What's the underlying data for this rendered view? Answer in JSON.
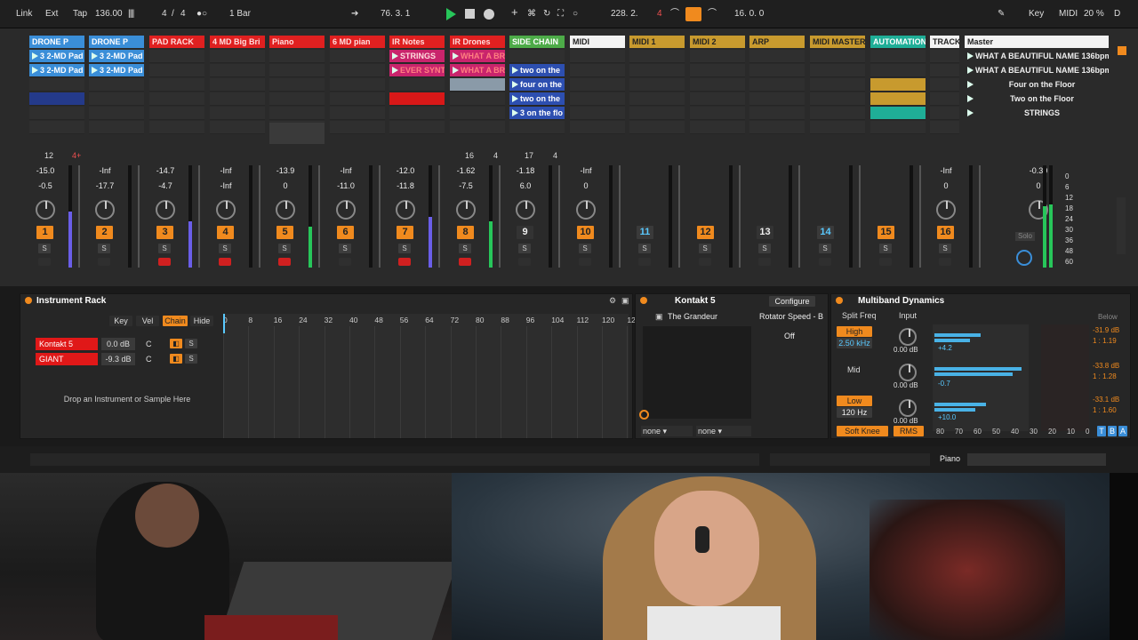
{
  "topbar": {
    "link": "Link",
    "ext": "Ext",
    "tap": "Tap",
    "tempo": "136.00",
    "meter_num": "4",
    "meter_slash": "/",
    "meter_den": "4",
    "metronome": "●○",
    "quant": "1 Bar",
    "position": "76. 3. 1",
    "loop_start": "228. 2.",
    "loop_marker": "4",
    "loop_len": "16. 0. 0",
    "key": "Key",
    "midi": "MIDI",
    "cpu": "20 %",
    "d": "D"
  },
  "tracks": [
    {
      "name": "DRONE P",
      "color": "#3a8ed8",
      "text": "#fff"
    },
    {
      "name": "DRONE P",
      "color": "#3a8ed8",
      "text": "#fff"
    },
    {
      "name": "PAD RACK",
      "color": "#e02020",
      "text": "#ffdede"
    },
    {
      "name": "4 MD Big Bri",
      "color": "#e02020",
      "text": "#ffdede"
    },
    {
      "name": "Piano",
      "color": "#e02020",
      "text": "#ffdede"
    },
    {
      "name": "6 MD pian",
      "color": "#e02020",
      "text": "#ffdede"
    },
    {
      "name": "IR Notes",
      "color": "#e02020",
      "text": "#ffdede"
    },
    {
      "name": "IR Drones",
      "color": "#e02020",
      "text": "#ffdede"
    },
    {
      "name": "SIDE CHAIN",
      "color": "#4dab48",
      "text": "#fff"
    },
    {
      "name": "MIDI",
      "color": "#f2f2f2",
      "text": "#222"
    },
    {
      "name": "MIDI 1",
      "color": "#c89a2e",
      "text": "#222"
    },
    {
      "name": "MIDI 2",
      "color": "#c89a2e",
      "text": "#222"
    },
    {
      "name": "ARP",
      "color": "#c89a2e",
      "text": "#222"
    },
    {
      "name": "MIDI MASTER",
      "color": "#c89a2e",
      "text": "#222"
    },
    {
      "name": "AUTOMATION",
      "color": "#1fae97",
      "text": "#fff"
    },
    {
      "name": "TRACKS",
      "color": "#f2f2f2",
      "text": "#222"
    },
    {
      "name": "Master",
      "color": "#f2f2f2",
      "text": "#222"
    }
  ],
  "clips": {
    "c1_1": "3 2-MD Pad",
    "c2_1": "3 2-MD Pad",
    "c1_7": "STRINGS",
    "c2_7": "EVER SYNT",
    "c4_7": "STRINGS",
    "c1_8": "WHAT A BR",
    "c2_8": "WHAT A BR",
    "c2_9": "two on the",
    "c3_9": "four on the",
    "c4_9": "two on the",
    "c5_9": "3 on the flo",
    "m1": "WHAT A BEAUTIFUL NAME 136bpm",
    "m2": "WHAT A BEAUTIFUL NAME 136bpm",
    "m3": "Four on the Floor",
    "m4": "Two on the Floor",
    "m5": "STRINGS"
  },
  "io": {
    "t1": "12",
    "t1b": "4+",
    "t8": "16",
    "t8b": "4",
    "t9": "17",
    "t9b": "4"
  },
  "volumes": [
    {
      "peak": "-15.0",
      "vol": "-0.5"
    },
    {
      "peak": "-Inf",
      "vol": "-17.7"
    },
    {
      "peak": "-14.7",
      "vol": "-4.7"
    },
    {
      "peak": "-Inf",
      "vol": "-Inf"
    },
    {
      "peak": "-13.9",
      "vol": "0"
    },
    {
      "peak": "-Inf",
      "vol": "-11.0"
    },
    {
      "peak": "-12.0",
      "vol": "-11.8"
    },
    {
      "peak": "-1.62",
      "vol": "-7.5"
    },
    {
      "peak": "-1.18",
      "vol": "6.0"
    },
    {
      "peak": "-Inf",
      "vol": "0"
    },
    {
      "peak": "",
      "vol": ""
    },
    {
      "peak": "",
      "vol": ""
    },
    {
      "peak": "",
      "vol": ""
    },
    {
      "peak": "",
      "vol": ""
    },
    {
      "peak": "",
      "vol": ""
    },
    {
      "peak": "-Inf",
      "vol": "0"
    },
    {
      "peak": "-0.30",
      "vol": "0"
    }
  ],
  "numbers": [
    "1",
    "2",
    "3",
    "4",
    "5",
    "6",
    "7",
    "8",
    "9",
    "10",
    "11",
    "12",
    "13",
    "14",
    "15",
    "16"
  ],
  "solo_label": "S",
  "master_solo": "Solo",
  "master_scale": [
    "0",
    "6",
    "12",
    "18",
    "24",
    "30",
    "36",
    "48",
    "60"
  ],
  "rack": {
    "title": "Instrument Rack",
    "key": "Key",
    "vel": "Vel",
    "chain": "Chain",
    "hide": "Hide",
    "chains": [
      {
        "name": "Kontakt 5",
        "vol": "0.0 dB",
        "pan": "C",
        "s": "S"
      },
      {
        "name": "GIANT",
        "vol": "-9.3 dB",
        "pan": "C",
        "s": "S"
      }
    ],
    "drop": "Drop an Instrument or Sample Here",
    "keys": [
      "0",
      "8",
      "16",
      "24",
      "32",
      "40",
      "48",
      "56",
      "64",
      "72",
      "80",
      "88",
      "96",
      "104",
      "112",
      "120",
      "127"
    ]
  },
  "kontakt": {
    "title": "Kontakt 5",
    "configure": "Configure",
    "preset": "The Grandeur",
    "param": "Rotator Speed - B",
    "state": "Off",
    "sel1": "none",
    "sel2": "none"
  },
  "multiband": {
    "title": "Multiband Dynamics",
    "split": "Split Freq",
    "input": "Input",
    "below": "Below",
    "high": "High",
    "high_freq": "2.50 kHz",
    "mid": "Mid",
    "low": "Low",
    "low_freq": "120 Hz",
    "in1": "0.00 dB",
    "in2": "0.00 dB",
    "in3": "0.00 dB",
    "g1": "+4.2",
    "g2": "-0.7",
    "g3": "+10.0",
    "r1": "-31.9 dB",
    "r1b": "1 : 1.19",
    "r2": "-33.8 dB",
    "r2b": "1 : 1.28",
    "r3": "-33.1 dB",
    "r3b": "1 : 1.60",
    "softknee": "Soft Knee",
    "rms": "RMS",
    "scale": [
      "80",
      "70",
      "60",
      "50",
      "40",
      "30",
      "20",
      "10",
      "0"
    ],
    "t": "T",
    "b": "B",
    "a": "A"
  },
  "status": {
    "track": "Piano"
  },
  "colors": {
    "orange": "#f08a1e",
    "red": "#e02020",
    "blue": "#3a8ed8",
    "green": "#27c65a",
    "cyan": "#59c9ff"
  }
}
